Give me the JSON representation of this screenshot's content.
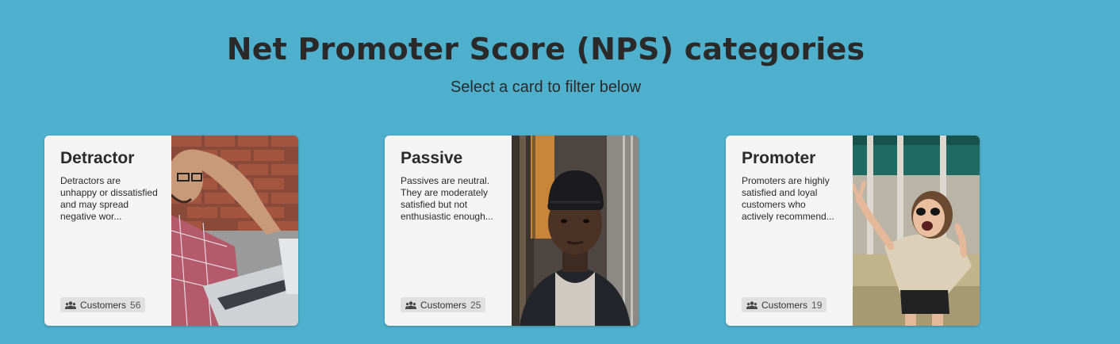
{
  "header": {
    "title": "Net Promoter Score (NPS) categories",
    "subtitle": "Select a card to filter below"
  },
  "cards": [
    {
      "title": "Detractor",
      "description": "Detractors are unhappy or dissatisfied and may spread negative wor...",
      "badge_label": "Customers",
      "count": "56",
      "icon": "people-icon"
    },
    {
      "title": "Passive",
      "description": "Passives are neutral. They are moderately satisfied but not enthusiastic enough...",
      "badge_label": "Customers",
      "count": "25",
      "icon": "people-icon"
    },
    {
      "title": "Promoter",
      "description": "Promoters are highly satisfied and loyal customers who actively recommend...",
      "badge_label": "Customers",
      "count": "19",
      "icon": "people-icon"
    }
  ],
  "colors": {
    "background": "#4fb0cd",
    "card": "#f4f4f4",
    "text": "#2a2a2a"
  }
}
